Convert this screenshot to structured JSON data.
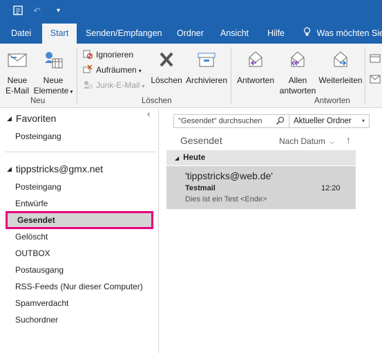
{
  "tabs": [
    {
      "label": "Datei"
    },
    {
      "label": "Start"
    },
    {
      "label": "Senden/Empfangen"
    },
    {
      "label": "Ordner"
    },
    {
      "label": "Ansicht"
    },
    {
      "label": "Hilfe"
    },
    {
      "label": "Was möchten Sie t"
    }
  ],
  "ribbon": {
    "neu": {
      "new_email": [
        "Neue",
        "E-Mail"
      ],
      "new_items": [
        "Neue",
        "Elemente"
      ],
      "group_label": "Neu"
    },
    "loeschen": {
      "ignore": "Ignorieren",
      "cleanup": "Aufräumen",
      "junk": "Junk-E-Mail",
      "delete": "Löschen",
      "archive": "Archivieren",
      "group_label": "Löschen"
    },
    "antworten": {
      "reply": "Antworten",
      "reply_all": [
        "Allen",
        "antworten"
      ],
      "forward": "Weiterleiten",
      "group_label": "Antworten"
    }
  },
  "folders": {
    "favorites_label": "Favoriten",
    "favorites": [
      "Posteingang"
    ],
    "account": "tippstricks@gmx.net",
    "items": [
      "Posteingang",
      "Entwürfe",
      "Gesendet",
      "Gelöscht",
      "OUTBOX",
      "Postausgang",
      "RSS-Feeds (Nur dieser Computer)",
      "Spamverdacht",
      "Suchordner"
    ],
    "selected": "Gesendet"
  },
  "messagelist": {
    "search_placeholder": "\"Gesendet\" durchsuchen",
    "scope": "Aktueller Ordner",
    "title": "Gesendet",
    "sort": "Nach Datum",
    "group": "Heute",
    "message": {
      "sender": "'tippstricks@web.de'",
      "subject": "Testmail",
      "time": "12:20",
      "preview": "Dies ist ein Test <Ende>"
    }
  },
  "colors": {
    "brand_blue": "#1d63b0",
    "highlight_border": "#e6007e"
  }
}
